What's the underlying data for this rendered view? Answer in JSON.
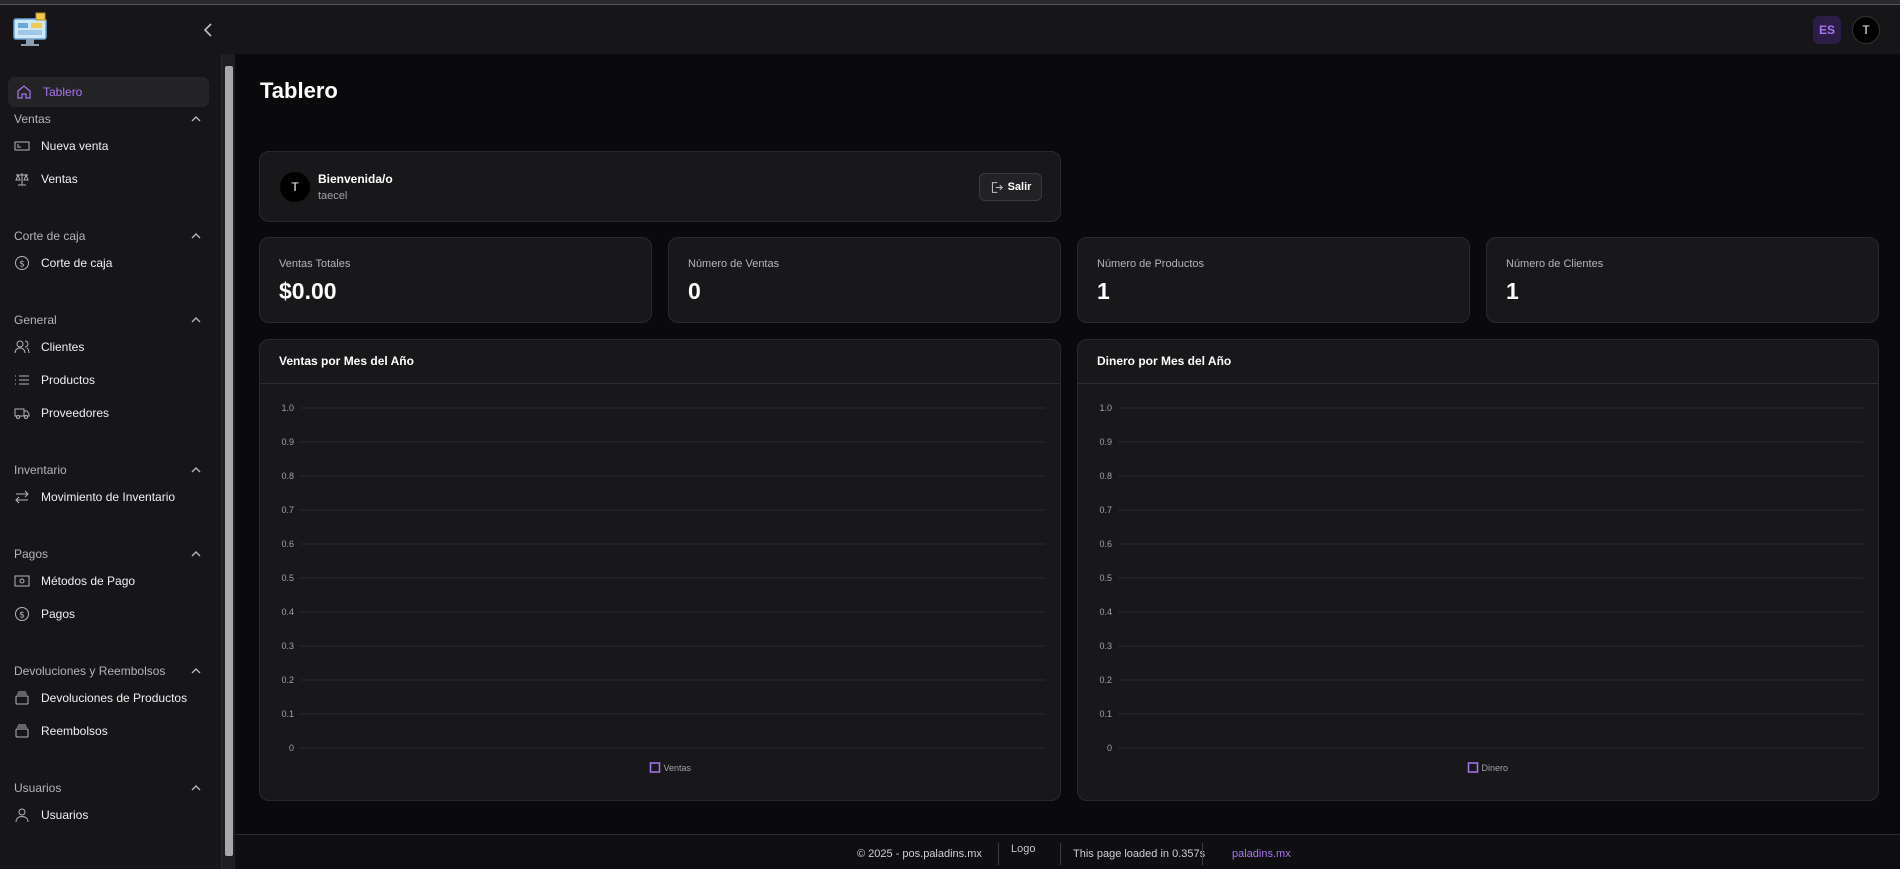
{
  "header": {
    "lang": "ES",
    "user_initial": "T"
  },
  "sidebar": {
    "active": {
      "label": "Tablero"
    },
    "sections": [
      {
        "title": "Ventas",
        "items": [
          {
            "label": "Nueva venta",
            "icon": "receipt-icon"
          },
          {
            "label": "Ventas",
            "icon": "scale-icon"
          }
        ]
      },
      {
        "title": "Corte de caja",
        "items": [
          {
            "label": "Corte de caja",
            "icon": "dollar-circle-icon"
          }
        ]
      },
      {
        "title": "General",
        "items": [
          {
            "label": "Clientes",
            "icon": "users-icon"
          },
          {
            "label": "Productos",
            "icon": "list-icon"
          },
          {
            "label": "Proveedores",
            "icon": "truck-icon"
          }
        ]
      },
      {
        "title": "Inventario",
        "items": [
          {
            "label": "Movimiento de Inventario",
            "icon": "arrows-icon"
          }
        ]
      },
      {
        "title": "Pagos",
        "items": [
          {
            "label": "Métodos de Pago",
            "icon": "banknote-icon"
          },
          {
            "label": "Pagos",
            "icon": "dollar-circle-icon"
          }
        ]
      },
      {
        "title": "Devoluciones y Reembolsos",
        "items": [
          {
            "label": "Devoluciones de Productos",
            "icon": "box-icon"
          },
          {
            "label": "Reembolsos",
            "icon": "box-icon"
          }
        ]
      },
      {
        "title": "Usuarios",
        "items": [
          {
            "label": "Usuarios",
            "icon": "user-icon"
          }
        ]
      }
    ]
  },
  "main": {
    "title": "Tablero",
    "welcome": {
      "initial": "T",
      "title": "Bienvenida/o",
      "username": "taecel",
      "logout": "Salir"
    },
    "stats": [
      {
        "label": "Ventas Totales",
        "value": "$0.00"
      },
      {
        "label": "Número de Ventas",
        "value": "0"
      },
      {
        "label": "Número de Productos",
        "value": "1"
      },
      {
        "label": "Número de Clientes",
        "value": "1"
      }
    ]
  },
  "chart_data": [
    {
      "type": "bar",
      "title": "Ventas por Mes del Año",
      "series": [
        {
          "name": "Ventas",
          "values": []
        }
      ],
      "ylim": [
        0,
        1.0
      ],
      "yticks": [
        "1.0",
        "0.9",
        "0.8",
        "0.7",
        "0.6",
        "0.5",
        "0.4",
        "0.3",
        "0.2",
        "0.1",
        "0"
      ],
      "legend": "bottom-center",
      "color": "#a775f0"
    },
    {
      "type": "bar",
      "title": "Dinero por Mes del Año",
      "series": [
        {
          "name": "Dinero",
          "values": []
        }
      ],
      "ylim": [
        0,
        1.0
      ],
      "yticks": [
        "1.0",
        "0.9",
        "0.8",
        "0.7",
        "0.6",
        "0.5",
        "0.4",
        "0.3",
        "0.2",
        "0.1",
        "0"
      ],
      "legend": "bottom-center",
      "color": "#a775f0"
    }
  ],
  "footer": {
    "copyright": "© 2025 - pos.paladins.mx",
    "logo_alt": "Logo",
    "load_time": "This page loaded in 0.357s",
    "link": "paladins.mx"
  }
}
